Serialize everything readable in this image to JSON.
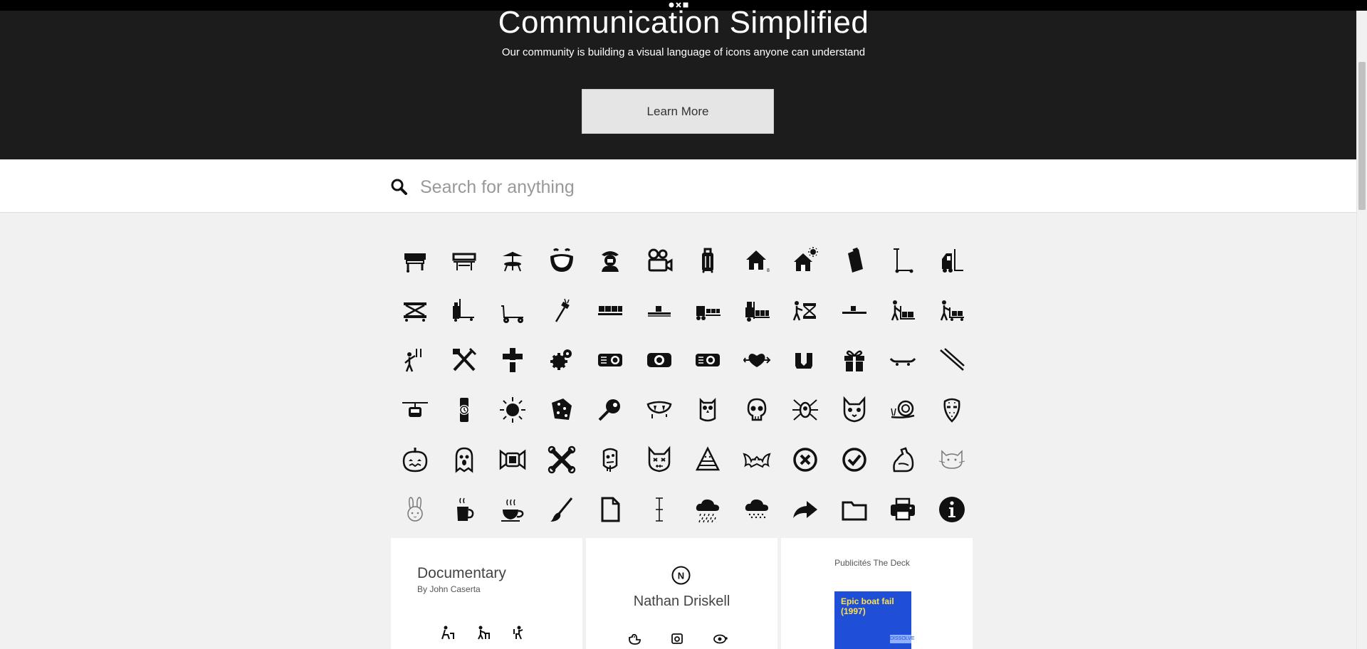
{
  "hero": {
    "title": "Communication Simplified",
    "subtitle": "Our community is building a visual language of icons anyone can understand",
    "button_label": "Learn More"
  },
  "search": {
    "placeholder": "Search for anything",
    "value": ""
  },
  "icons": [
    "grill-icon",
    "grill-outline-icon",
    "table-umbrella-icon",
    "laughing-face-icon",
    "cowboy-icon",
    "movie-camera-icon",
    "suitcase-icon",
    "house-icon",
    "house-sun-icon",
    "clipboard-icon",
    "scooter-icon",
    "forklift-icon",
    "scissor-lift-icon",
    "pallet-jack-icon",
    "cart-icon",
    "hammer-icon",
    "pallet-boxes-icon",
    "pallet-icon",
    "forklift-boxes-icon",
    "forklift-loaded-icon",
    "worker-lift-icon",
    "platform-icon",
    "worker-pallet-icon",
    "worker-cart-icon",
    "worker-tools-icon",
    "tools-crossed-icon",
    "cross-icon",
    "gears-icon",
    "projector-icon",
    "projector-2-icon",
    "projector-3-icon",
    "heart-arrow-icon",
    "socks-icon",
    "gift-icon",
    "skateboard-icon",
    "chopsticks-icon",
    "cable-car-icon",
    "watch-icon",
    "sun-icon",
    "dice-icon",
    "magnifier-icon",
    "vampire-mouth-icon",
    "owl-icon",
    "skull-icon",
    "spider-icon",
    "cat-face-icon",
    "snail-icon",
    "hockey-mask-icon",
    "pumpkin-icon",
    "ghost-icon",
    "candy-icon",
    "crossbones-icon",
    "zombie-icon",
    "frankencat-icon",
    "candy-corn-icon",
    "bat-icon",
    "close-circle-icon",
    "check-circle-icon",
    "flexed-arm-icon",
    "cat-outline-icon",
    "rabbit-icon",
    "mug-icon",
    "coffee-cup-icon",
    "paintbrush-icon",
    "document-icon",
    "text-cursor-icon",
    "rain-cloud-icon",
    "snow-cloud-icon",
    "share-arrow-icon",
    "folder-icon",
    "printer-icon",
    "info-icon"
  ],
  "cards": [
    {
      "title": "Documentary",
      "subtitle": "By John Caserta",
      "icons": [
        "worker-sitting-icon",
        "worker-table-icon",
        "worker-chair-icon"
      ]
    },
    {
      "logo": "N",
      "title": "Nathan Driskell",
      "icons": [
        "duck-icon",
        "camera-box-icon",
        "turtle-icon"
      ]
    },
    {
      "label": "Publicités The Deck",
      "thumb_title": "Epic boat fail (1997)",
      "thumb_stamp": "DISSOLVE"
    }
  ]
}
